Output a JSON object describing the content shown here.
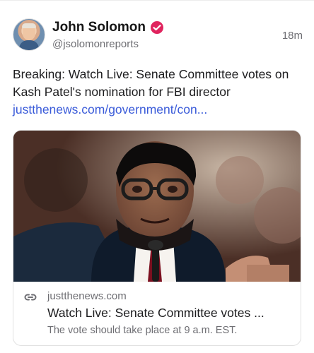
{
  "post": {
    "author_name": "John Solomon",
    "handle": "@jsolomonreports",
    "time": "18m",
    "text": "Breaking: Watch Live: Senate Committee votes on Kash Patel's nomination for FBI director",
    "link_text": "justthenews.com/government/con..."
  },
  "link_card": {
    "domain": "justthenews.com",
    "title": "Watch Live: Senate Committee votes ...",
    "description": "The vote should take place at 9 a.m. EST."
  },
  "colors": {
    "verified_badge": "#e0245e",
    "link": "#3a5bd9"
  },
  "icons": {
    "verified": "verified-badge-icon",
    "link": "link-icon"
  }
}
